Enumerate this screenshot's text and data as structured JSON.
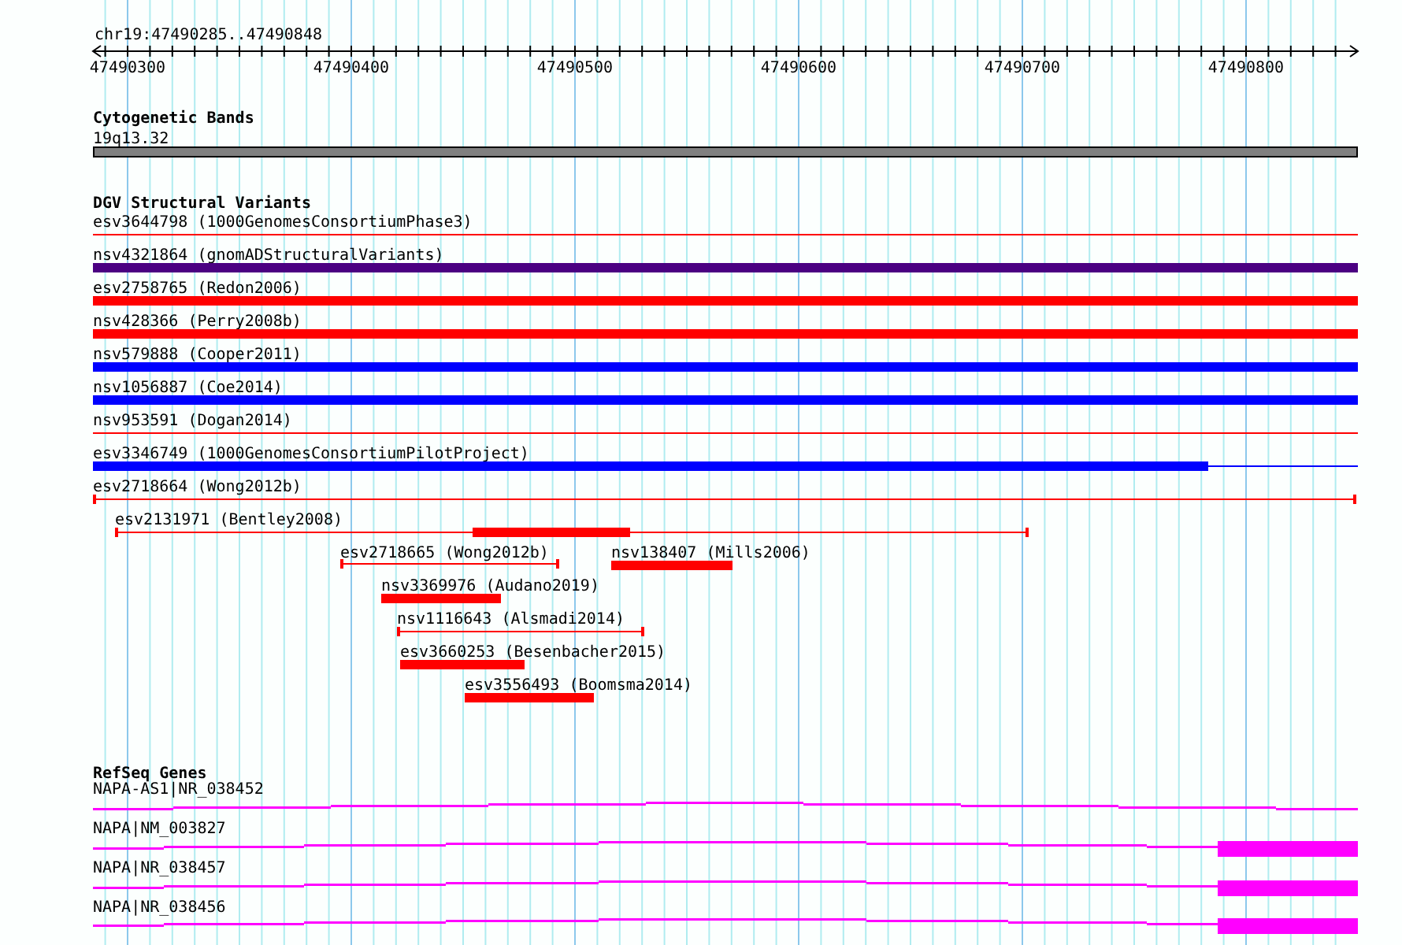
{
  "ruler": {
    "location": "chr19:47490285..47490848",
    "ticks": [
      "47490300",
      "47490400",
      "47490500",
      "47490600",
      "47490700",
      "47490800"
    ]
  },
  "cytogenetic_bands": {
    "title": "Cytogenetic Bands",
    "features": [
      {
        "label": "19q13.32",
        "color": "#808080"
      }
    ]
  },
  "dgv_structural_variants": {
    "title": "DGV Structural Variants",
    "features": [
      {
        "label": "esv3644798 (1000GenomesConsortiumPhase3)",
        "kind": "line",
        "color": "#ff0000"
      },
      {
        "label": "nsv4321864 (gnomADStructuralVariants)",
        "kind": "bar",
        "color": "#4b0082"
      },
      {
        "label": "esv2758765 (Redon2006)",
        "kind": "bar",
        "color": "#ff0000"
      },
      {
        "label": "nsv428366 (Perry2008b)",
        "kind": "bar",
        "color": "#ff0000"
      },
      {
        "label": "nsv579888 (Cooper2011)",
        "kind": "bar",
        "color": "#0000ff"
      },
      {
        "label": "nsv1056887 (Coe2014)",
        "kind": "bar",
        "color": "#0000ff"
      },
      {
        "label": "nsv953591 (Dogan2014)",
        "kind": "line",
        "color": "#ff0000"
      },
      {
        "label": "esv3346749 (1000GenomesConsortiumPilotProject)",
        "kind": "bar_line",
        "color": "#0000ff"
      },
      {
        "label": "esv2718664 (Wong2012b)",
        "kind": "capped",
        "color": "#ff0000"
      },
      {
        "label": "esv2131971 (Bentley2008)",
        "kind": "capped_bar",
        "color": "#ff0000"
      },
      {
        "label": "esv2718665 (Wong2012b)",
        "kind": "capped",
        "color": "#ff0000"
      },
      {
        "label": "nsv138407 (Mills2006)",
        "kind": "bar",
        "color": "#ff0000"
      },
      {
        "label": "nsv3369976 (Audano2019)",
        "kind": "bar",
        "color": "#ff0000"
      },
      {
        "label": "nsv1116643 (Alsmadi2014)",
        "kind": "capped",
        "color": "#ff0000"
      },
      {
        "label": "esv3660253 (Besenbacher2015)",
        "kind": "bar",
        "color": "#ff0000"
      },
      {
        "label": "esv3556493 (Boomsma2014)",
        "kind": "bar",
        "color": "#ff0000"
      }
    ]
  },
  "refseq_genes": {
    "title": "RefSeq Genes",
    "features": [
      {
        "label": "NAPA-AS1|NR_038452",
        "kind": "noncoding"
      },
      {
        "label": "NAPA|NM_003827",
        "kind": "coding"
      },
      {
        "label": "NAPA|NR_038457",
        "kind": "coding"
      },
      {
        "label": "NAPA|NR_038456",
        "kind": "coding"
      }
    ]
  }
}
